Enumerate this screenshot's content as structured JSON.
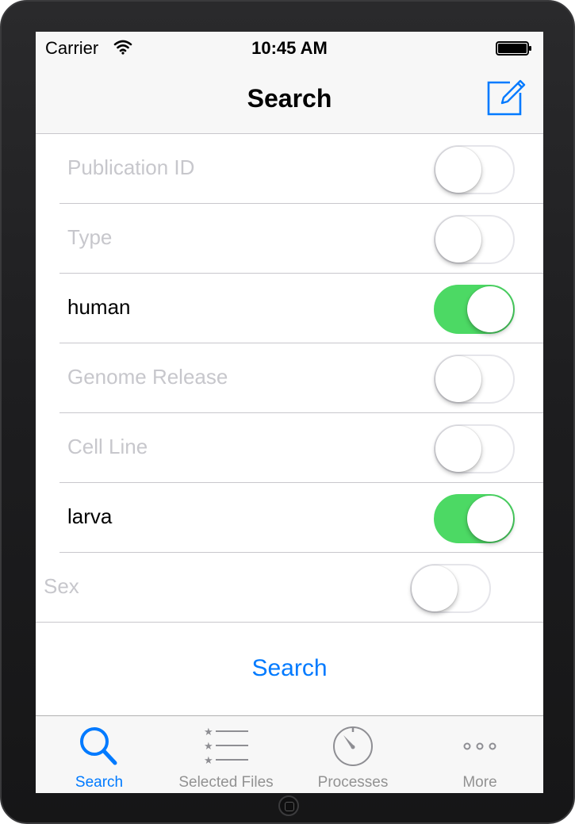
{
  "status_bar": {
    "carrier": "Carrier",
    "time": "10:45 AM"
  },
  "nav_bar": {
    "title": "Search",
    "right_icon": "compose-icon"
  },
  "filters": [
    {
      "label": "Publication ID",
      "on": false
    },
    {
      "label": "Type",
      "on": false
    },
    {
      "label": "human",
      "on": true
    },
    {
      "label": "Genome Release",
      "on": false
    },
    {
      "label": "Cell Line",
      "on": false
    },
    {
      "label": "larva",
      "on": true
    },
    {
      "label": "Sex",
      "on": false
    }
  ],
  "search_action": {
    "label": "Search"
  },
  "tab_bar": {
    "tabs": [
      {
        "label": "Search",
        "icon": "search-icon",
        "active": true
      },
      {
        "label": "Selected Files",
        "icon": "starred-list-icon",
        "active": false
      },
      {
        "label": "Processes",
        "icon": "gauge-icon",
        "active": false
      },
      {
        "label": "More",
        "icon": "more-icon",
        "active": false
      }
    ]
  },
  "colors": {
    "accent": "#007aff",
    "switch_on": "#4cd964",
    "disabled_text": "#c7c7cc",
    "bar_background": "#f7f7f7"
  }
}
